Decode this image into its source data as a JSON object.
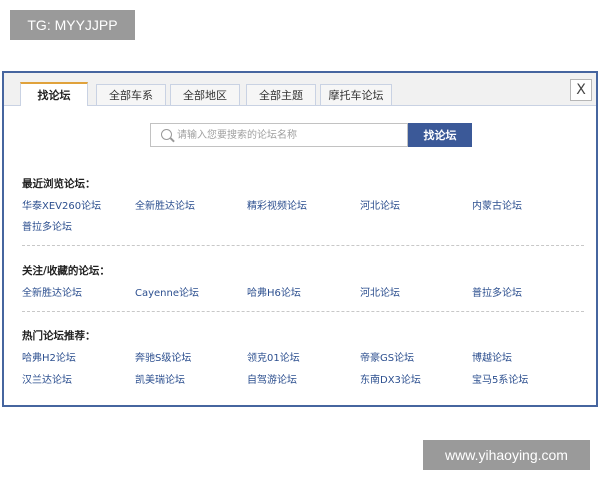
{
  "watermarks": {
    "top": "TG: MYYJJPP",
    "bottom": "www.yihaoying.com"
  },
  "dialog": {
    "tabs": [
      "找论坛",
      "全部车系",
      "全部地区",
      "全部主题",
      "摩托车论坛"
    ],
    "close_label": "X",
    "search": {
      "placeholder": "请输入您要搜索的论坛名称",
      "button": "找论坛"
    },
    "sections": [
      {
        "title": "最近浏览论坛：",
        "items": [
          "华泰XEV260论坛",
          "全新胜达论坛",
          "精彩视频论坛",
          "河北论坛",
          "内蒙古论坛",
          "普拉多论坛"
        ]
      },
      {
        "title": "关注/收藏的论坛：",
        "items": [
          "全新胜达论坛",
          "Cayenne论坛",
          "哈弗H6论坛",
          "河北论坛",
          "普拉多论坛"
        ]
      },
      {
        "title": "热门论坛推荐：",
        "items": [
          "哈弗H2论坛",
          "奔驰S级论坛",
          "领克01论坛",
          "帝豪GS论坛",
          "博越论坛",
          "汉兰达论坛",
          "凯美瑞论坛",
          "自驾游论坛",
          "东南DX3论坛",
          "宝马5系论坛"
        ]
      }
    ]
  }
}
